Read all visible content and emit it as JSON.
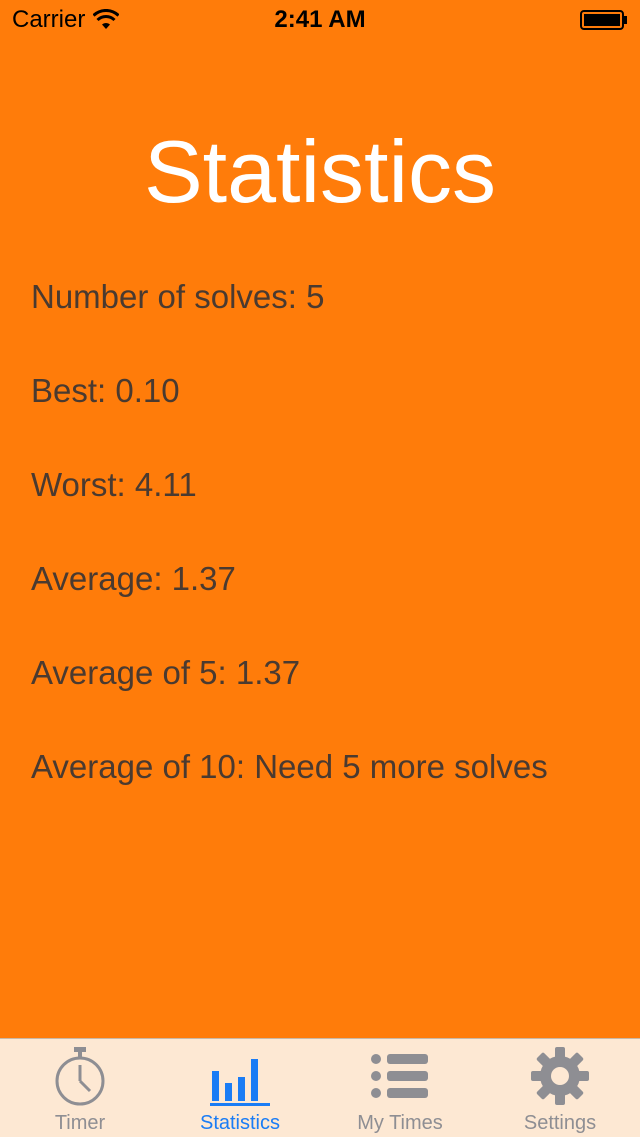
{
  "status_bar": {
    "carrier": "Carrier",
    "time": "2:41 AM",
    "wifi_icon": "wifi-icon",
    "battery_icon": "battery-full-icon"
  },
  "title": "Statistics",
  "stats": [
    {
      "text": "Number of solves: 5"
    },
    {
      "text": "Best: 0.10"
    },
    {
      "text": "Worst: 4.11"
    },
    {
      "text": "Average: 1.37"
    },
    {
      "text": "Average of 5: 1.37"
    },
    {
      "text": "Average of 10: Need 5 more solves"
    }
  ],
  "tabs": [
    {
      "label": "Timer",
      "icon": "stopwatch-icon",
      "active": false
    },
    {
      "label": "Statistics",
      "icon": "bar-chart-icon",
      "active": true
    },
    {
      "label": "My Times",
      "icon": "list-icon",
      "active": false
    },
    {
      "label": "Settings",
      "icon": "gear-icon",
      "active": false
    }
  ],
  "colors": {
    "background": "#FF7C0A",
    "title": "#FFFFFF",
    "stat_text": "#4A3A30",
    "tab_bar": "#FDE8D3",
    "tab_active": "#1A7CF5",
    "tab_inactive": "#8E8E93"
  }
}
